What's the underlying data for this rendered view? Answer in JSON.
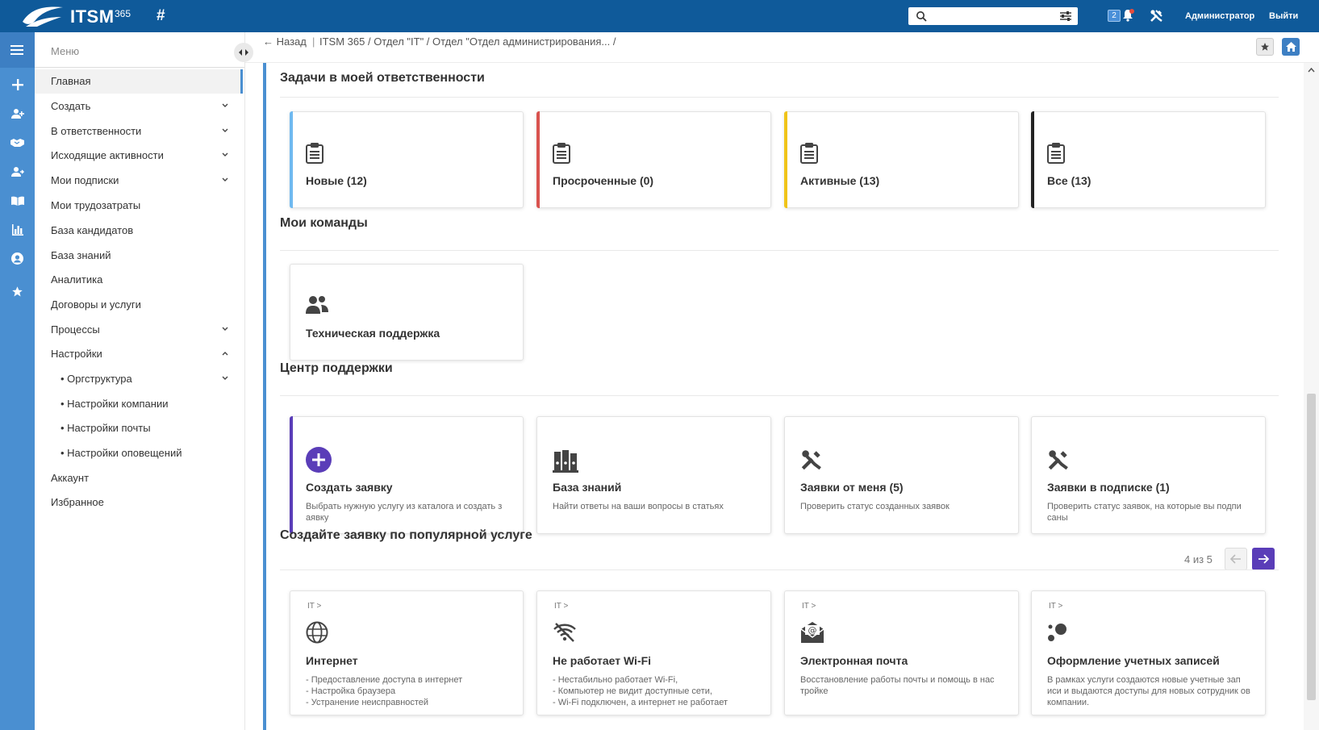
{
  "app": {
    "logo_text": "ITSM",
    "logo_sup": "365",
    "hash_label": "#"
  },
  "topbar": {
    "search_placeholder": "",
    "notif_count": "2",
    "admin": "Администратор",
    "logout": "Выйти"
  },
  "colors": {
    "topbar": "#0f5a9a",
    "rail": "#4a8fd1",
    "new": "#6fb9f0",
    "overdue": "#d9534f",
    "active": "#f0c419",
    "all": "#222222",
    "create": "#5a3db8"
  },
  "menu": {
    "header": "Меню",
    "items": [
      {
        "label": "Главная"
      },
      {
        "label": "Создать"
      },
      {
        "label": "В ответственности"
      },
      {
        "label": "Исходящие активности"
      },
      {
        "label": "Мои подписки"
      },
      {
        "label": "Мои трудозатраты"
      },
      {
        "label": "База кандидатов"
      },
      {
        "label": "База знаний"
      },
      {
        "label": "Аналитика"
      },
      {
        "label": "Договоры и услуги"
      },
      {
        "label": "Процессы"
      },
      {
        "label": "Настройки"
      },
      {
        "label": "• Оргструктура"
      },
      {
        "label": "• Настройки компании"
      },
      {
        "label": "• Настройки почты"
      },
      {
        "label": "• Настройки оповещений"
      },
      {
        "label": "Аккаунт"
      },
      {
        "label": "Избранное"
      }
    ]
  },
  "breadcrumb": {
    "back": "← Назад",
    "sep": "|",
    "path": "ITSM 365 / Отдел \"IT\" / Отдел \"Отдел администрирования... /"
  },
  "sections": {
    "tasks": {
      "title": "Задачи в моей ответственности",
      "cards": [
        {
          "label": "Новые (12)"
        },
        {
          "label": "Просроченные (0)"
        },
        {
          "label": "Активные (13)"
        },
        {
          "label": "Все (13)"
        }
      ]
    },
    "teams": {
      "title": "Мои команды",
      "cards": [
        {
          "label": "Техническая поддержка"
        }
      ]
    },
    "support": {
      "title": "Центр поддержки",
      "cards": [
        {
          "label": "Создать заявку",
          "desc": "Выбрать нужную услугу из каталога и создать з аявку"
        },
        {
          "label": "База знаний",
          "desc": "Найти ответы на ваши вопросы в статьях"
        },
        {
          "label": "Заявки от меня (5)",
          "desc": "Проверить статус созданных заявок"
        },
        {
          "label": "Заявки в подписке (1)",
          "desc": "Проверить статус заявок, на которые вы подпи саны"
        }
      ]
    },
    "popular": {
      "title": "Создайте заявку по популярной услуге",
      "pager": "4 из 5",
      "cards": [
        {
          "cat": "IT >",
          "label": "Интернет",
          "desc": "- Предоставление доступа в интернет\n- Настройка браузера\n- Устранение неисправностей"
        },
        {
          "cat": "IT >",
          "label": "Не работает Wi-Fi",
          "desc": "- Нестабильно работает Wi-Fi,\n- Компьютер не видит доступные сети,\n- Wi-Fi подключен, а интернет не работает"
        },
        {
          "cat": "IT >",
          "label": "Электронная почта",
          "desc": "Восстановление работы почты и помощь в нас тройке"
        },
        {
          "cat": "IT >",
          "label": "Оформление учетных записей",
          "desc": "В рамках услуги создаются новые учетные зап иси и выдаются доступы для новых сотрудник ов компании."
        }
      ]
    }
  }
}
